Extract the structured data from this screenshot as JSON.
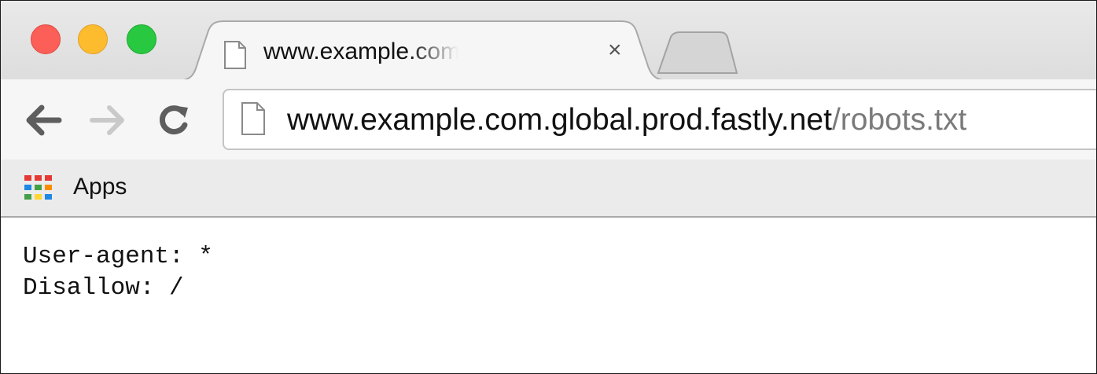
{
  "window": {
    "traffic_lights": {
      "close_color": "#fc5f57",
      "minimize_color": "#fdbc2e",
      "maximize_color": "#28c840"
    }
  },
  "tab": {
    "title": "www.example.com.global.prod.fastly.net/robots.txt",
    "icon": "document-icon",
    "close_label": "×"
  },
  "toolbar": {
    "back_icon": "back-arrow-icon",
    "forward_icon": "forward-arrow-icon",
    "reload_icon": "reload-icon",
    "url_host": "www.example.com.global.prod.fastly.net",
    "url_path": "/robots.txt"
  },
  "bookmarks": {
    "apps_label": "Apps",
    "apps_icon": "apps-grid-icon"
  },
  "page": {
    "lines": [
      "User-agent: *",
      "Disallow: /"
    ]
  }
}
